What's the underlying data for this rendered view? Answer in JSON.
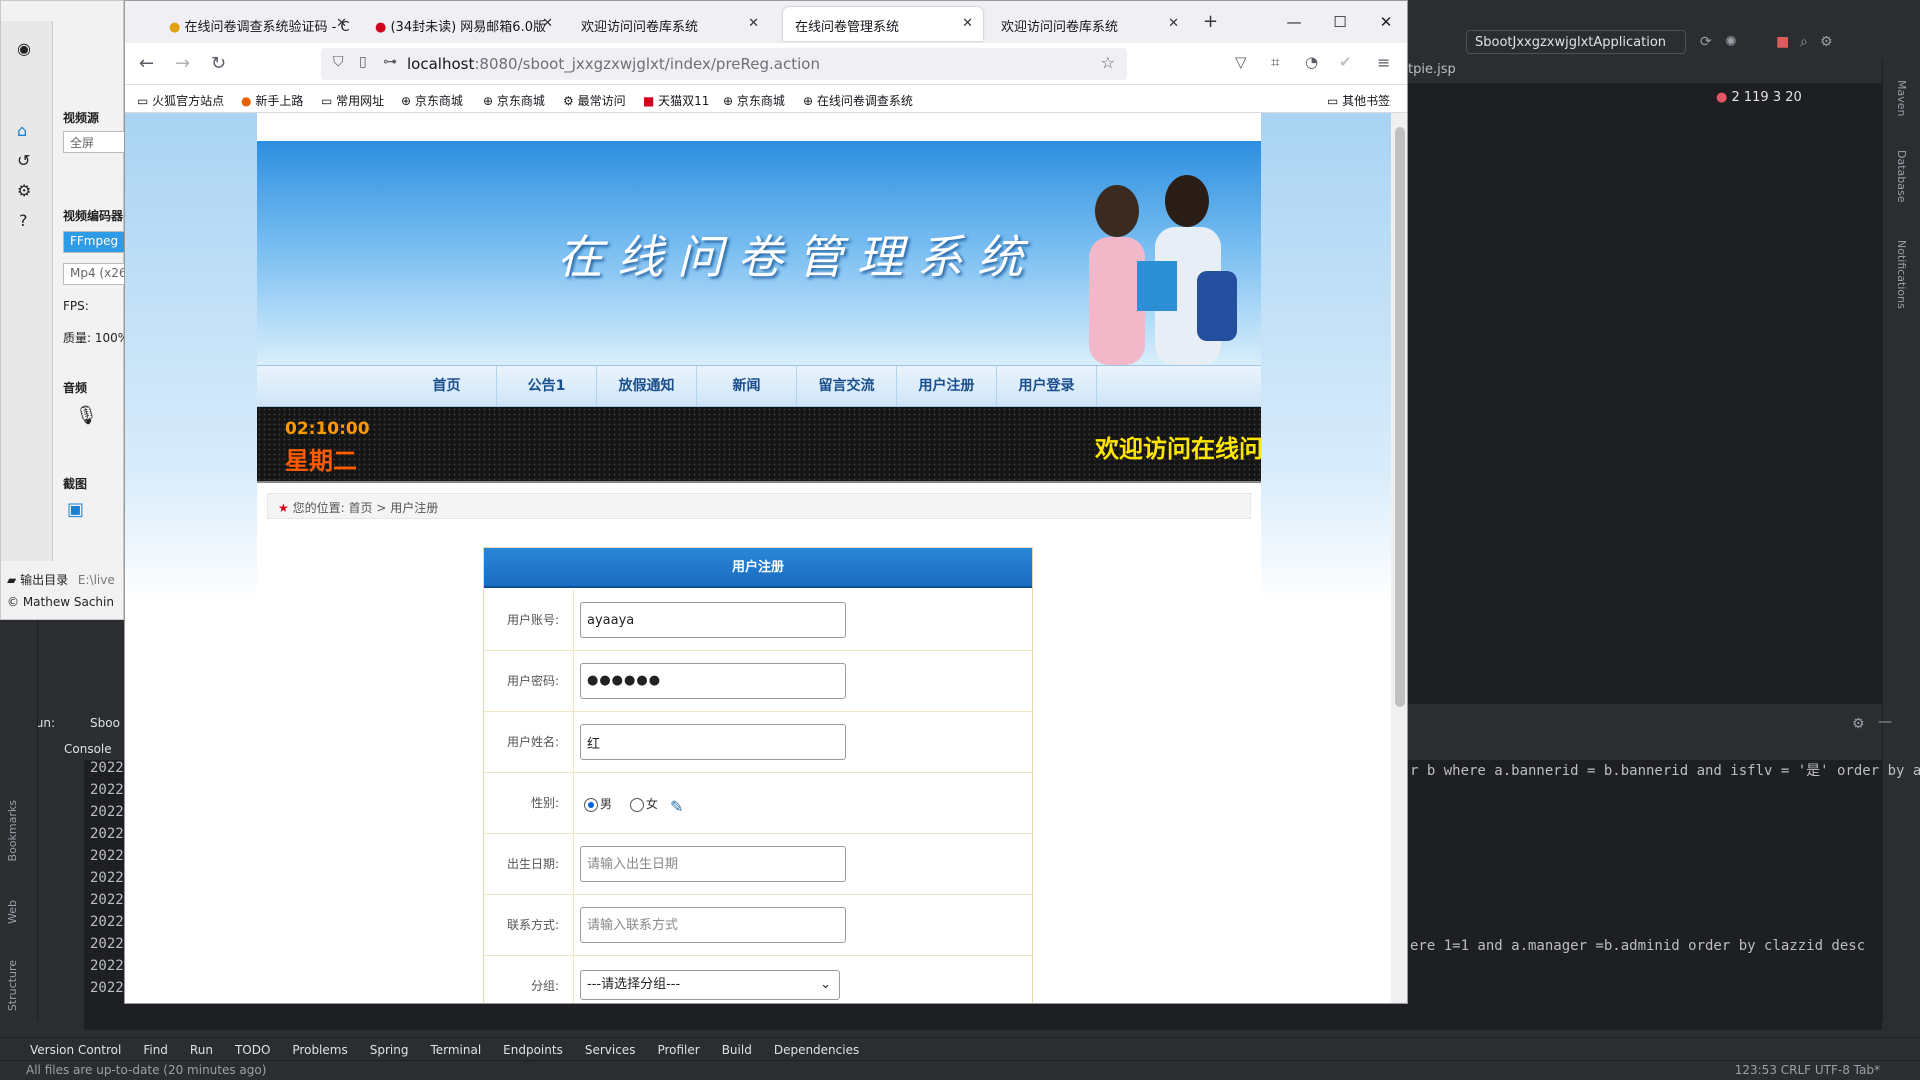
{
  "browser": {
    "tabs": [
      {
        "label": "在线问卷调查系统验证码 - C"
      },
      {
        "label": "(34封未读) 网易邮箱6.0版"
      },
      {
        "label": "欢迎访问问卷库系统"
      },
      {
        "label": "在线问卷管理系统"
      },
      {
        "label": "欢迎访问问卷库系统"
      }
    ],
    "url_host": "localhost",
    "url_path": ":8080/sboot_jxxgzxwjglxt/index/preReg.action",
    "bookmarks": [
      "火狐官方站点",
      "新手上路",
      "常用网址",
      "京东商城",
      "京东商城",
      "最常访问",
      "天猫双11",
      "京东商城",
      "在线问卷调查系统"
    ],
    "other_bookmarks": "其他书签"
  },
  "site": {
    "title": "在线问卷管理系统",
    "nav": [
      "首页",
      "公告1",
      "放假通知",
      "新闻",
      "留言交流",
      "用户注册",
      "用户登录"
    ],
    "clock_time": "02:10:00",
    "clock_day": "星期二",
    "marquee": "欢迎访问在线问",
    "breadcrumb_label": "您的位置:",
    "breadcrumb_home": "首页",
    "breadcrumb_sep": ">",
    "breadcrumb_current": "用户注册"
  },
  "form": {
    "header": "用户注册",
    "fields": [
      {
        "label": "用户账号:",
        "value": "ayaaya",
        "placeholder": ""
      },
      {
        "label": "用户密码:",
        "value": "●●●●●●",
        "placeholder": ""
      },
      {
        "label": "用户姓名:",
        "value": "红",
        "placeholder": ""
      },
      {
        "label": "性别:"
      },
      {
        "label": "出生日期:",
        "value": "",
        "placeholder": "请输入出生日期"
      },
      {
        "label": "联系方式:",
        "value": "",
        "placeholder": "请输入联系方式"
      },
      {
        "label": "分组:"
      }
    ],
    "gender_options": [
      "男",
      "女"
    ],
    "gender_selected": "男",
    "group_select": "---请选择分组---"
  },
  "recorder": {
    "video_source_label": "视频源",
    "video_source_value": "全屏",
    "encoder_label": "视频编码器",
    "encoder_value": "FFmpeg",
    "format_value": "Mp4 (x26",
    "fps_label": "FPS:",
    "quality_label": "质量: 100%",
    "audio_label": "音频",
    "screenshot_label": "截图",
    "output_label": "输出目录",
    "output_value": "E:\\live",
    "credit": "© Mathew Sachin"
  },
  "ide": {
    "run_config": "SbootJxxgzxwjglxtApplication",
    "editor_tab": "tpie.jsp",
    "inspections": "2   119   3   20",
    "run_label": "Run:",
    "run_tab": "Sboo",
    "console_tab": "Console",
    "console_year": "2022",
    "console_line1": "r b where a.bannerid = b.bannerid and isflv = '是' order by ai",
    "console_line2": "ere 1=1 and a.manager =b.adminid order by clazzid desc",
    "bottom_tools": [
      "Version Control",
      "Find",
      "Run",
      "TODO",
      "Problems",
      "Spring",
      "Terminal",
      "Endpoints",
      "Services",
      "Profiler",
      "Build",
      "Dependencies"
    ],
    "status": "All files are up-to-date (20 minutes ago)",
    "status_right": "123:53   CRLF   UTF-8   Tab*",
    "side_labels": [
      "Maven",
      "Database",
      "Notifications"
    ],
    "left_labels": [
      "Bookmarks",
      "Web",
      "Structure"
    ]
  }
}
